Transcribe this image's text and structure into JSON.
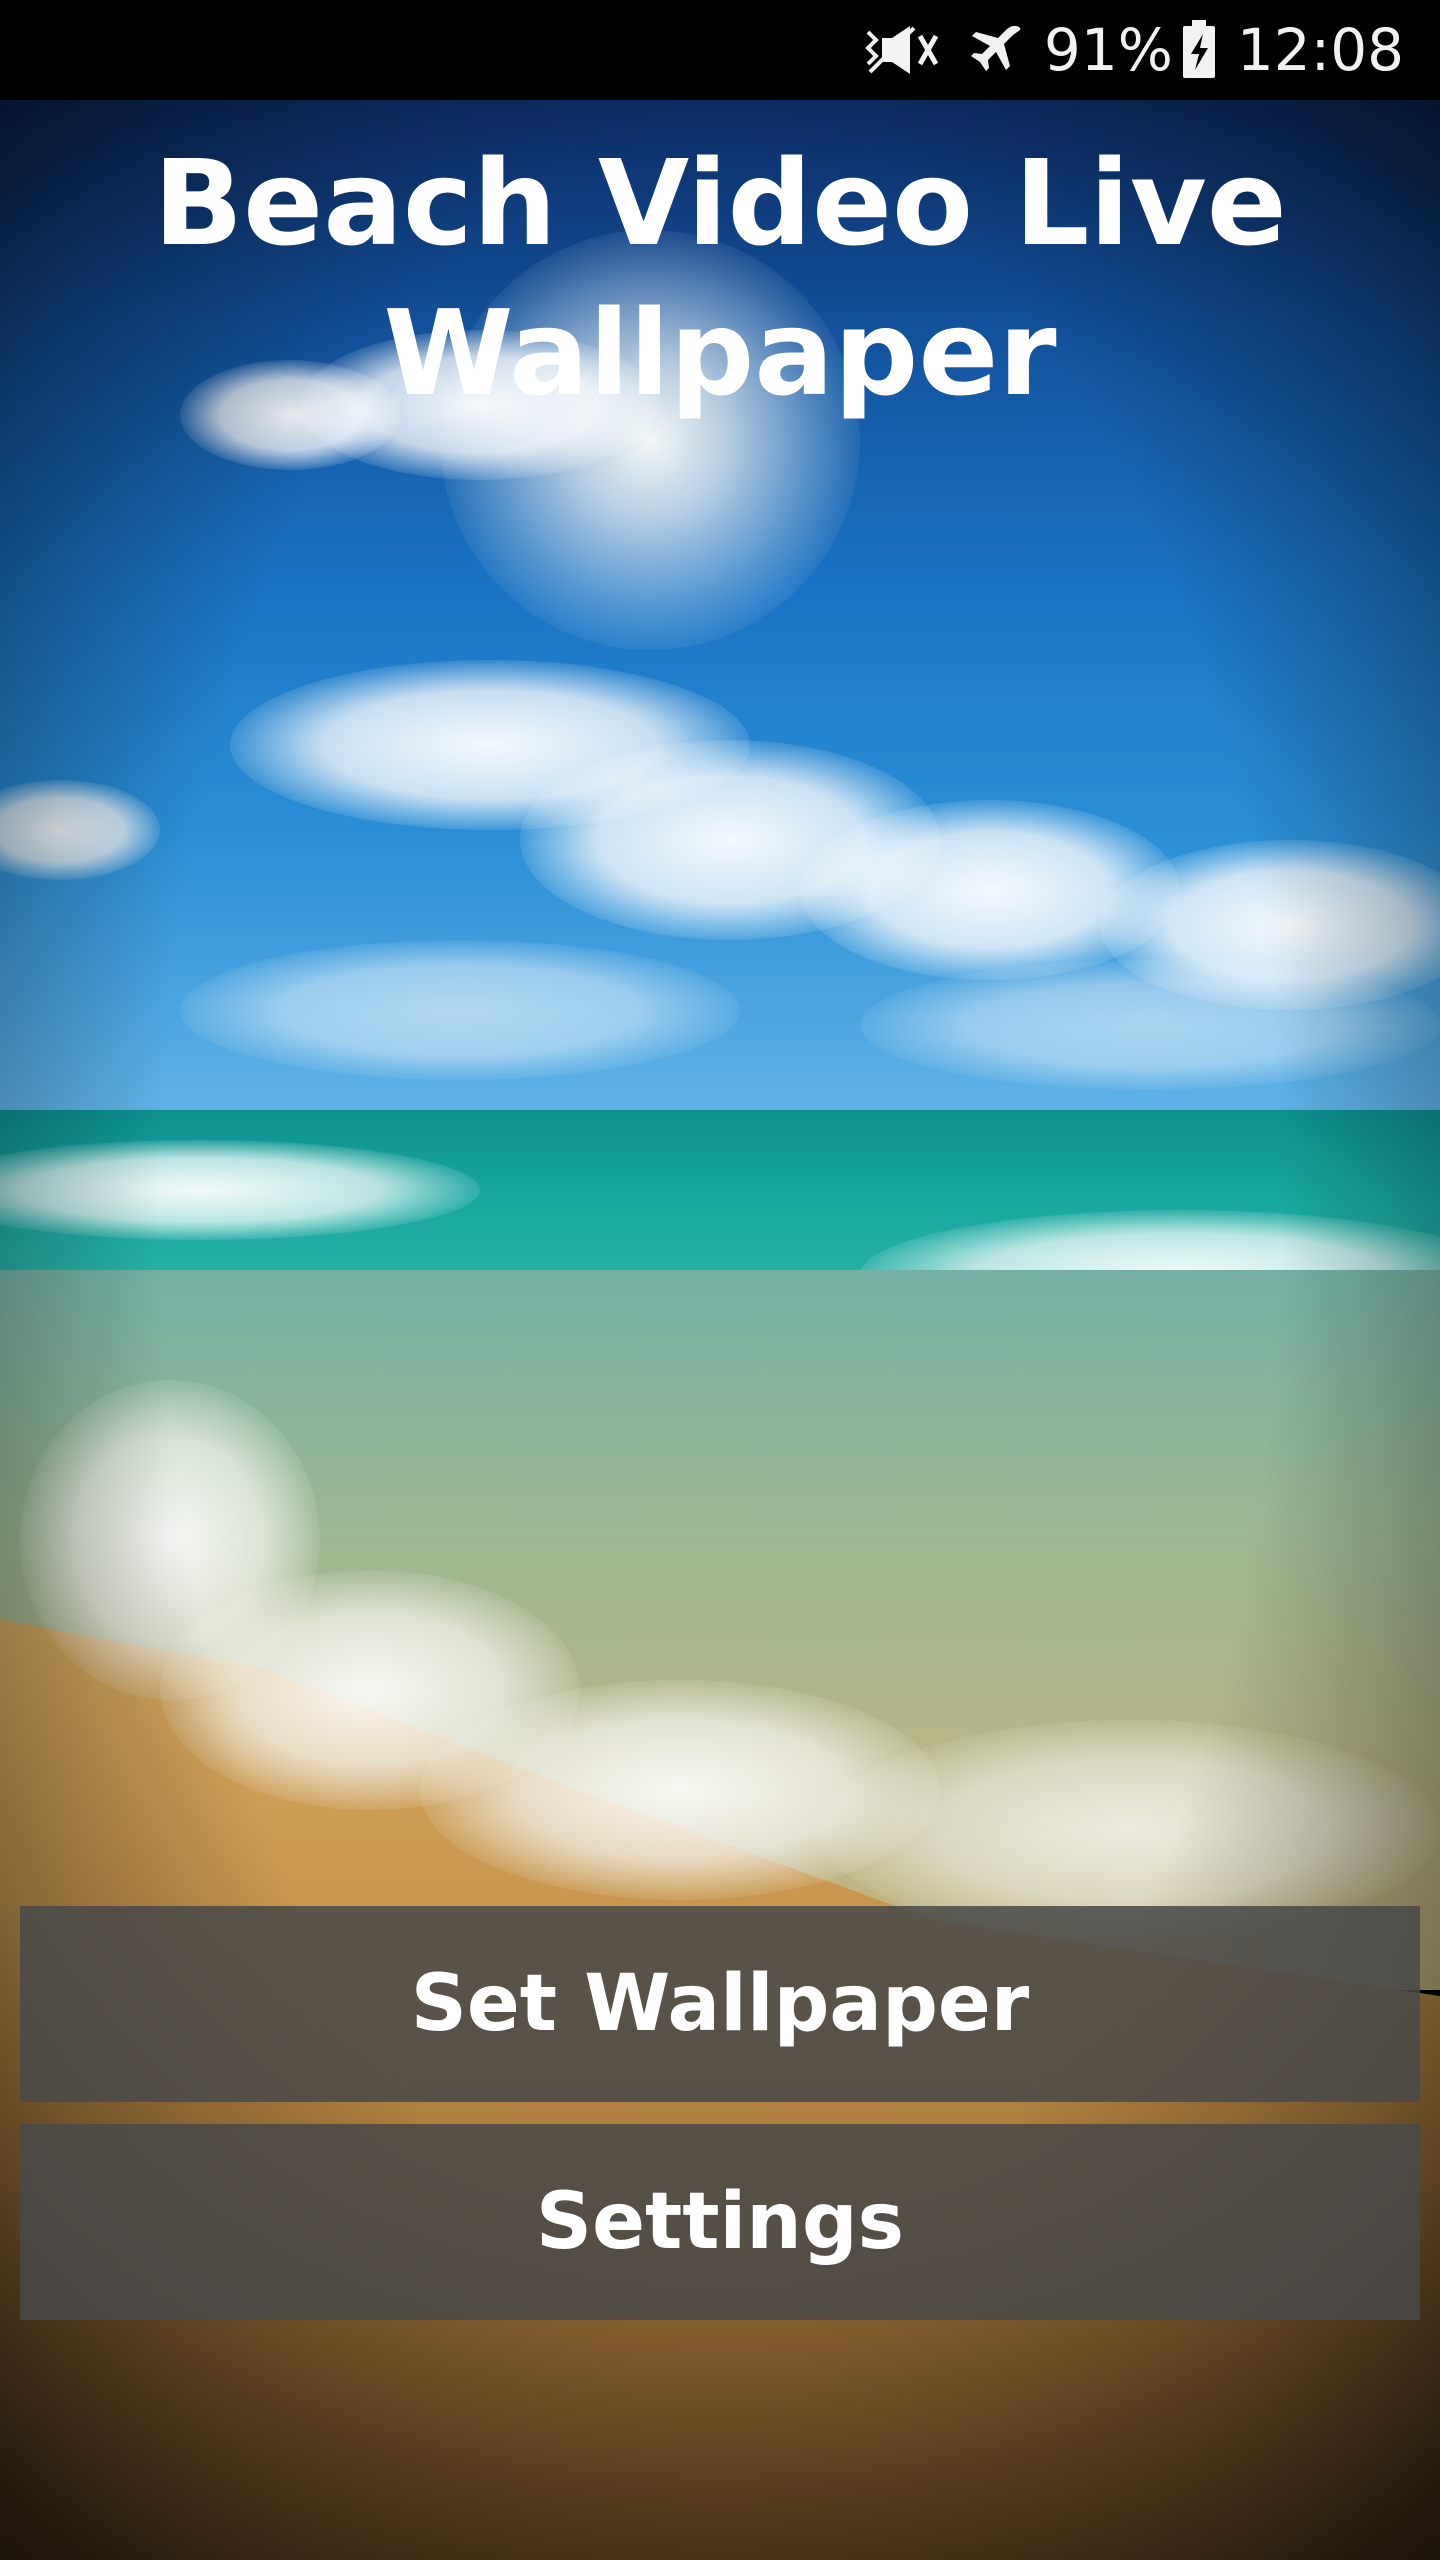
{
  "status_bar": {
    "battery_percent_text": "91%",
    "time": "12:08",
    "icons": [
      "vibrate-mute-icon",
      "airplane-mode-icon",
      "battery-charging-icon"
    ]
  },
  "app": {
    "title_line1": "Beach Video Live",
    "title_line2": "Wallpaper"
  },
  "buttons": {
    "set_wallpaper": "Set Wallpaper",
    "settings": "Settings"
  }
}
